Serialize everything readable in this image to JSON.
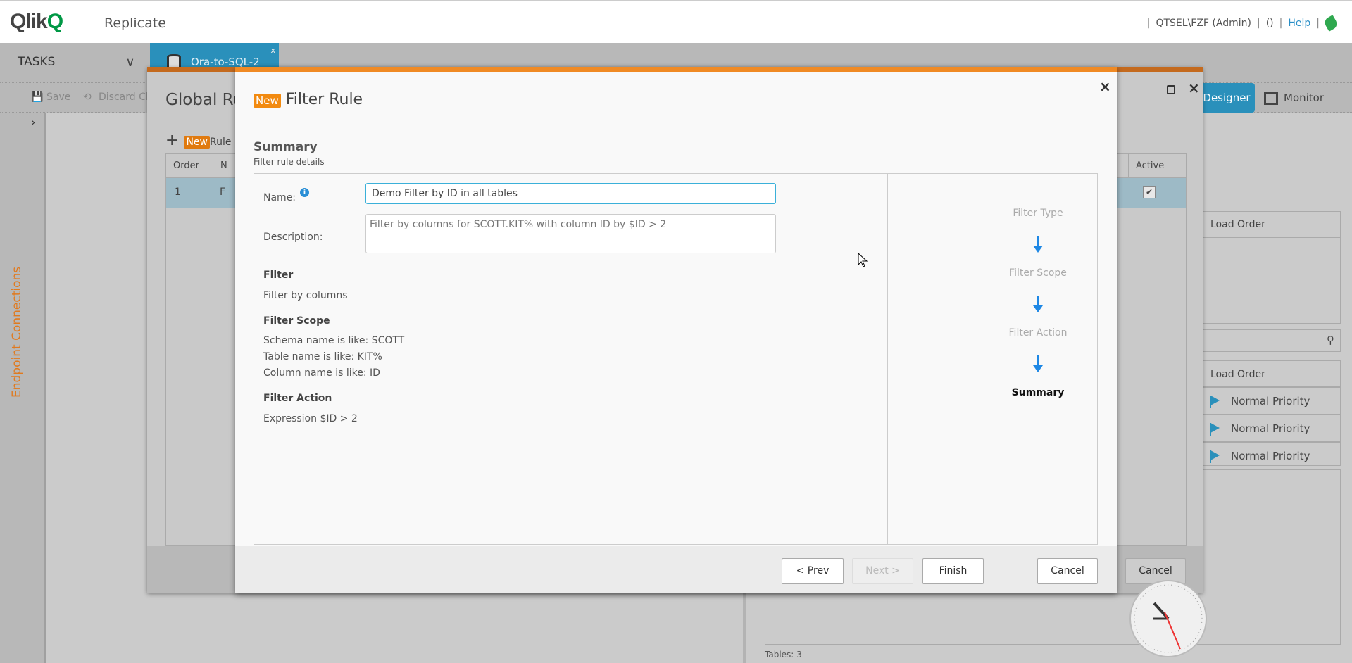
{
  "header": {
    "logo": "Qlik",
    "app_name": "Replicate",
    "user": "QTSEL\\FZF (Admin)",
    "notifications": "()",
    "help": "Help"
  },
  "tasks_bar": {
    "label": "TASKS",
    "tab_label": "Ora-to-SQL-2",
    "tab_close": "x"
  },
  "toolbar": {
    "save": "Save",
    "discard": "Discard Ch",
    "designer": "Designer",
    "monitor": "Monitor"
  },
  "sidebar": {
    "label": "Endpoint Connections"
  },
  "right_panel": {
    "load_order_header": "Load Order",
    "load_order_header2": "Load Order",
    "rows": [
      "Normal Priority",
      "Normal Priority",
      "Normal Priority"
    ],
    "tables_count": "Tables: 3"
  },
  "global_rules": {
    "title": "Global Ru",
    "new_badge": "New",
    "new_rule": "Rule",
    "columns": {
      "order": "Order",
      "name": "N",
      "active": "Active"
    },
    "rows": [
      {
        "order": "1",
        "name": "F",
        "active": true
      }
    ],
    "cancel": "Cancel"
  },
  "filter_rule": {
    "new_badge": "New",
    "title": "Filter Rule",
    "section_title": "Summary",
    "section_subtitle": "Filter rule details",
    "name_label": "Name:",
    "name_value": "Demo Filter by ID in all tables",
    "description_label": "Description:",
    "description_placeholder": "Filter by columns for SCOTT.KIT% with column ID by $ID > 2",
    "filter_heading": "Filter",
    "filter_value": "Filter by columns",
    "scope_heading": "Filter Scope",
    "scope_schema": "Schema name is like: SCOTT",
    "scope_table": "Table name is like: KIT%",
    "scope_column": "Column name is like: ID",
    "action_heading": "Filter Action",
    "action_value": "Expression $ID > 2",
    "steps": [
      "Filter Type",
      "Filter Scope",
      "Filter Action",
      "Summary"
    ],
    "buttons": {
      "prev": "< Prev",
      "next": "Next >",
      "finish": "Finish",
      "cancel": "Cancel"
    }
  },
  "colors": {
    "accent_orange": "#f08a24",
    "tab_blue": "#2a90bb",
    "qlik_green": "#009845"
  }
}
